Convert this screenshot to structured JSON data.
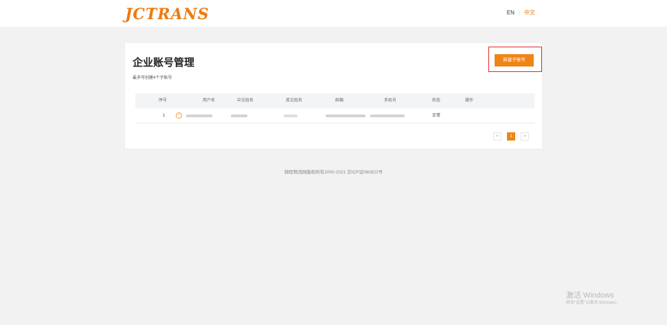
{
  "header": {
    "logo_text": "JCTRANS",
    "lang_en": "EN",
    "lang_separator": "|",
    "lang_zh": "中文"
  },
  "card": {
    "title": "企业账号管理",
    "subtitle": "最多可创建4个子账号",
    "new_button_label": "新建子账号"
  },
  "table": {
    "columns": [
      "序号",
      "用户名",
      "中文姓名",
      "英文姓名",
      "邮箱",
      "手机号",
      "状态",
      "操作"
    ],
    "rows": [
      {
        "index": "1",
        "username": "",
        "chinese_name": "",
        "english_name": "",
        "email": "",
        "phone": "",
        "status": "正常",
        "actions": ""
      }
    ]
  },
  "pagination": {
    "prev_icon": "chevron-left-icon",
    "prev_label": "<",
    "current_page": "1",
    "next_icon": "chevron-right-icon",
    "next_label": ">"
  },
  "footer": {
    "copyright": "锦程物流网版权所有2000-2021 京ICP证060822号"
  },
  "os_watermark": {
    "title": "激活 Windows",
    "subtitle": "转到\"设置\"以激活 Windows。"
  },
  "colors": {
    "accent": "#f08517",
    "highlight_border": "#e0242a",
    "page_background": "#f2f2f2"
  }
}
